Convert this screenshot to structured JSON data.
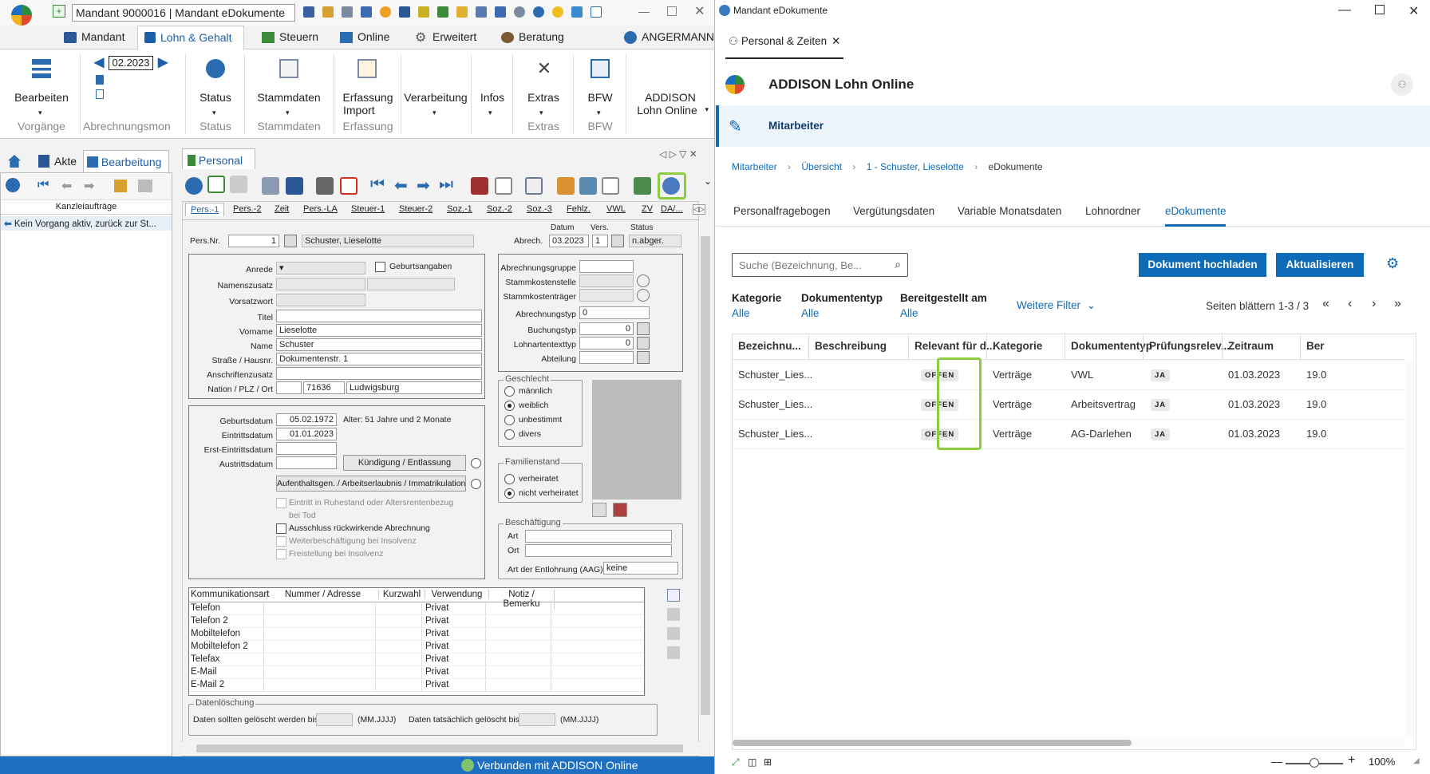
{
  "left": {
    "mandant": "Mandant 9000016   |   Mandant eDokumente",
    "ribbon_tabs": [
      "Mandant",
      "Lohn & Gehalt",
      "Steuern",
      "Online",
      "Erweitert",
      "Beratung"
    ],
    "user": "ANGERMANN",
    "period": "02.2023",
    "ribbon": {
      "bearbeiten": "Bearbeiten",
      "vorgaenge": "Vorgänge",
      "abrechnungsmonat": "Abrechnungsmon",
      "status": "Status",
      "status_cap": "Status",
      "stammdaten": "Stammdaten",
      "stammdaten_cap": "Stammdaten",
      "erfassung_import": "Erfassung",
      "erfassung_import2": "Import",
      "erfassung_cap": "Erfassung",
      "verarbeitung": "Verarbeitung",
      "infos": "Infos",
      "extras": "Extras",
      "extras_cap": "Extras",
      "bfw": "BFW",
      "bfw_cap": "BFW",
      "addison1": "ADDISON",
      "addison2": "Lohn Online"
    },
    "side_tabs": [
      "Akte",
      "Bearbeitung"
    ],
    "kanzlei_header": "Kanzleiaufträge",
    "kanzlei_item": "Kein Vorgang aktiv, zurück zur St...",
    "personal_tab": "Personal",
    "sub_tabs": [
      "Pers.-1",
      "Pers.-2",
      "Zeit",
      "Pers.-LA",
      "Steuer-1",
      "Steuer-2",
      "Soz.-1",
      "Soz.-2",
      "Soz.-3",
      "Fehlz.",
      "VWL",
      "ZV",
      "DA/..."
    ],
    "header_fields": {
      "persnr_label": "Pers.Nr.",
      "persnr": "1",
      "name": "Schuster, Lieselotte",
      "datum_label": "Datum",
      "vers_label": "Vers.",
      "status_label": "Status",
      "abrech_label": "Abrech.",
      "datum": "03.2023",
      "vers": "1",
      "status": "n.abger."
    },
    "person": {
      "anrede": "Anrede",
      "geburtsangaben": "Geburtsangaben",
      "namenszusatz": "Namenszusatz",
      "vorsatzwort": "Vorsatzwort",
      "titel": "Titel",
      "vorname_label": "Vorname",
      "vorname": "Lieselotte",
      "name_label": "Name",
      "name": "Schuster",
      "strasse_label": "Straße / Hausnr.",
      "strasse": "Dokumentenstr. 1",
      "anschriftenzusatz": "Anschriftenzusatz",
      "nation_label": "Nation / PLZ / Ort",
      "plz": "71636",
      "ort": "Ludwigsburg"
    },
    "abrechnung": {
      "abrechnungsgruppe": "Abrechnungsgruppe",
      "stammkostenstelle": "Stammkostenstelle",
      "stammkostentraeger": "Stammkostenträger",
      "abrechnungstyp": "Abrechnungstyp",
      "abrechnungstyp_val": "0",
      "buchungstyp": "Buchungstyp",
      "buchungstyp_val": "0",
      "lohnartentexttyp": "Lohnartentexttyp",
      "lohnartentexttyp_val": "0",
      "abteilung": "Abteilung"
    },
    "dates": {
      "geburtsdatum_label": "Geburtsdatum",
      "geburtsdatum": "05.02.1972",
      "alter": "Alter: 51 Jahre und 2 Monate",
      "eintritt_label": "Eintrittsdatum",
      "eintritt": "01.01.2023",
      "ersteintritt_label": "Erst-Eintrittsdatum",
      "austritt_label": "Austrittsdatum",
      "kuendigung_btn": "Kündigung / Entlassung",
      "aufenthalt_btn": "Aufenthaltsgen. / Arbeitserlaubnis / Immatrikulation",
      "ruhestand": "Eintritt in Ruhestand oder Altersrentenbezug",
      "tod": "bei Tod",
      "ausschluss": "Ausschluss rückwirkende Abrechnung",
      "weiterbesch": "Weiterbeschäftigung bei Insolvenz",
      "freistellung": "Freistellung bei Insolvenz"
    },
    "geschlecht": {
      "title": "Geschlecht",
      "options": [
        "männlich",
        "weiblich",
        "unbestimmt",
        "divers"
      ],
      "selected": "weiblich"
    },
    "familienstand": {
      "title": "Familienstand",
      "options": [
        "verheiratet",
        "nicht verheiratet"
      ],
      "selected": "nicht verheiratet"
    },
    "beschaeftigung": {
      "title": "Beschäftigung",
      "art": "Art",
      "ort": "Ort",
      "entlohnung_label": "Art der Entlohnung (AAG)",
      "entlohnung": "keine"
    },
    "komm": {
      "headers": [
        "Kommunikationsart",
        "Nummer / Adresse",
        "Kurzwahl",
        "Verwendung",
        "Notiz / Bemerku"
      ],
      "rows": [
        [
          "Telefon",
          "",
          "",
          "Privat",
          ""
        ],
        [
          "Telefon 2",
          "",
          "",
          "Privat",
          ""
        ],
        [
          "Mobiltelefon",
          "",
          "",
          "Privat",
          ""
        ],
        [
          "Mobiltelefon 2",
          "",
          "",
          "Privat",
          ""
        ],
        [
          "Telefax",
          "",
          "",
          "Privat",
          ""
        ],
        [
          "E-Mail",
          "",
          "",
          "Privat",
          ""
        ],
        [
          "E-Mail 2",
          "",
          "",
          "Privat",
          ""
        ]
      ]
    },
    "datenloeschung": {
      "title": "Datenlöschung",
      "soll_label": "Daten sollten gelöscht werden bis",
      "fmt1": "(MM.JJJJ)",
      "tats_label": "Daten tatsächlich gelöscht bis",
      "fmt2": "(MM.JJJJ)"
    },
    "statusbar": "Verbunden mit ADDISON Online"
  },
  "right": {
    "window_title": "Mandant eDokumente",
    "tab": "Personal & Zeiten",
    "app_title": "ADDISON Lohn Online",
    "section": "Mitarbeiter",
    "breadcrumb": [
      "Mitarbeiter",
      "Übersicht",
      "1 - Schuster, Lieselotte",
      "eDokumente"
    ],
    "tabs": [
      "Personalfragebogen",
      "Vergütungsdaten",
      "Variable Monatsdaten",
      "Lohnordner",
      "eDokumente"
    ],
    "active_tab": "eDokumente",
    "search_placeholder": "Suche (Bezeichnung, Be...",
    "upload_btn": "Dokument hochladen",
    "refresh_btn": "Aktualisieren",
    "filters": [
      {
        "label": "Kategorie",
        "value": "Alle"
      },
      {
        "label": "Dokumententyp",
        "value": "Alle"
      },
      {
        "label": "Bereitgestellt am",
        "value": "Alle"
      }
    ],
    "more_filters": "Weitere Filter",
    "pager": "Seiten blättern 1-3 / 3",
    "columns": [
      "Bezeichnu...",
      "Beschreibung",
      "Relevant für d...",
      "Kategorie",
      "Dokumententyp",
      "Prüfungsrelev...",
      "Zeitraum",
      "Ber"
    ],
    "rows": [
      {
        "bez": "Schuster_Lies...",
        "desc": "",
        "relevant": "OFFEN",
        "kategorie": "Verträge",
        "typ": "VWL",
        "pruef": "JA",
        "zeitraum": "01.03.2023",
        "ber": "19.0"
      },
      {
        "bez": "Schuster_Lies...",
        "desc": "",
        "relevant": "OFFEN",
        "kategorie": "Verträge",
        "typ": "Arbeitsvertrag",
        "pruef": "JA",
        "zeitraum": "01.03.2023",
        "ber": "19.0"
      },
      {
        "bez": "Schuster_Lies...",
        "desc": "",
        "relevant": "OFFEN",
        "kategorie": "Verträge",
        "typ": "AG-Darlehen",
        "pruef": "JA",
        "zeitraum": "01.03.2023",
        "ber": "19.0"
      }
    ],
    "zoom": "100%"
  },
  "colors": {
    "accent": "#0e6bb8",
    "highlight": "#8ccd3f",
    "statusbar": "#1d6fc2"
  }
}
